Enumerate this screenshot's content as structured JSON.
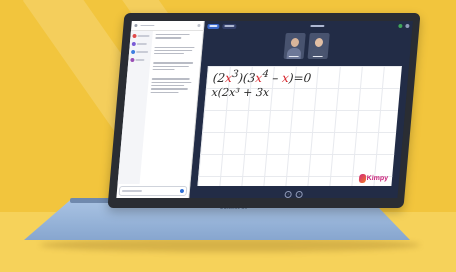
{
  "brand": {
    "base_label": "MacBook Air"
  },
  "chat": {
    "contacts": [
      {
        "color": "#e04b4b"
      },
      {
        "color": "#7a5bd6"
      },
      {
        "color": "#3f7fe0"
      },
      {
        "color": "#9a4fb5"
      }
    ]
  },
  "whiteboard": {
    "equation_line1_parts": [
      "(2",
      "x",
      "3",
      ")(3",
      "x",
      "4",
      " – ",
      "x",
      ")=0"
    ],
    "equation_line2": "x(2x³ + 3x"
  },
  "logo": {
    "text": "Kimpy"
  },
  "colors": {
    "background": "#f2c53d",
    "accent": "#3a67c9",
    "ink_red": "#d7262d",
    "logo": "#c9227a"
  }
}
